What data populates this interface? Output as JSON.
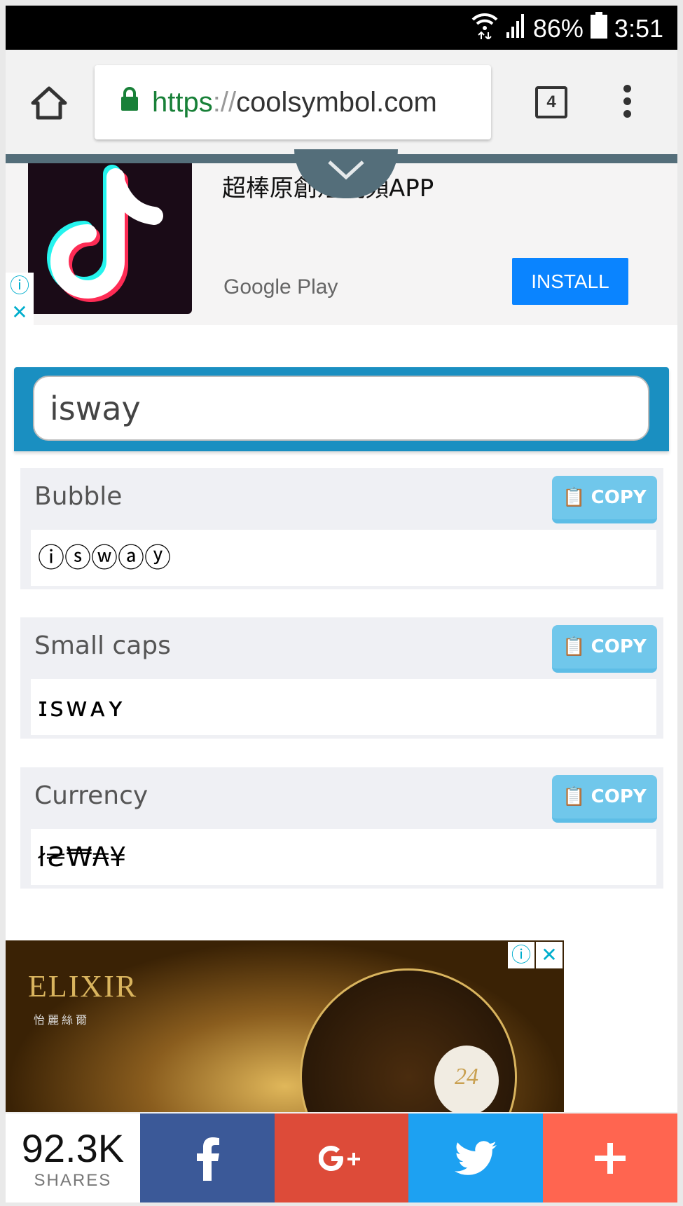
{
  "status_bar": {
    "battery": "86%",
    "time": "3:51"
  },
  "browser": {
    "url_scheme": "https",
    "url_sep": "://",
    "url_host": "coolsymbol.com",
    "tab_count": "4"
  },
  "ad_top": {
    "title": "超棒原創短視頻APP",
    "store": "Google Play",
    "install_label": "INSTALL",
    "info": "ⓘ",
    "close": "✕"
  },
  "search": {
    "value": "isway"
  },
  "results": [
    {
      "label": "Bubble",
      "value": "ⓘⓢⓦⓐⓨ",
      "copy_label": "COPY"
    },
    {
      "label": "Small caps",
      "value": "ɪꜱᴡᴀʏ",
      "copy_label": "COPY"
    },
    {
      "label": "Currency",
      "value": "ł₴₩₳¥",
      "copy_label": "COPY"
    }
  ],
  "ad_bottom": {
    "brand": "ELIXIR",
    "sub": "怡麗絲爾",
    "badge": "24",
    "info": "ⓘ",
    "close": "✕"
  },
  "share": {
    "count": "92.3K",
    "label": "SHARES",
    "colors": {
      "facebook": "#3b5998",
      "google_plus": "#dd4b39",
      "twitter": "#1da1f2",
      "more": "#ff6550"
    }
  }
}
